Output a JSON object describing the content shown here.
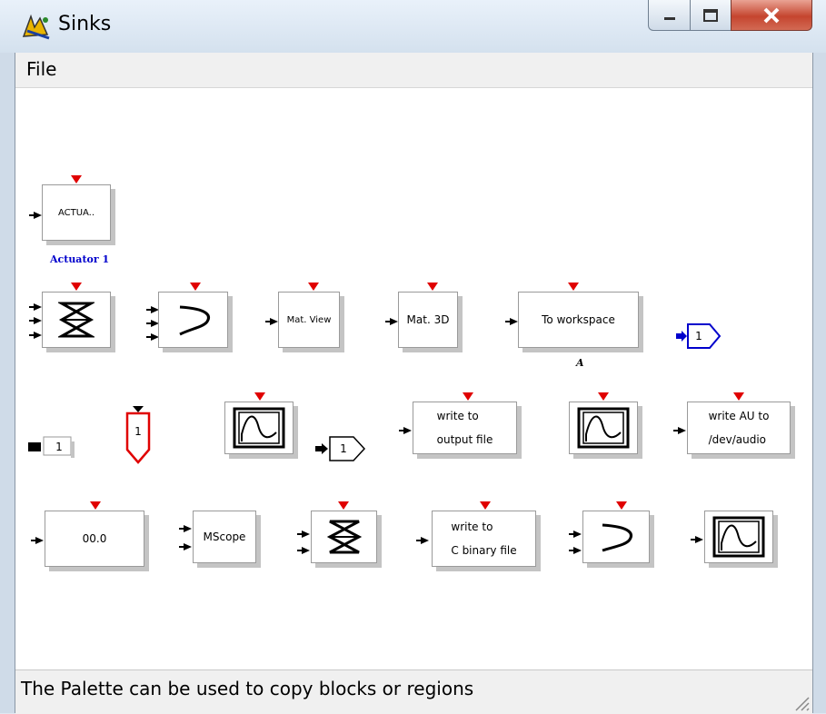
{
  "window": {
    "title": "Sinks"
  },
  "menu": {
    "file": "File"
  },
  "status": {
    "text": "The Palette can be used to copy blocks or regions"
  },
  "colors": {
    "event_port": "#e00000",
    "link_blue": "#0000cc"
  },
  "blocks": {
    "actuator": {
      "label": "ACTUA..",
      "caption": "Actuator 1"
    },
    "mat_view": {
      "label": "Mat. View"
    },
    "mat_3d": {
      "label": "Mat. 3D"
    },
    "to_workspace": {
      "label": "To workspace",
      "caption": "A"
    },
    "out_port_blue": {
      "label": "1"
    },
    "const_display": {
      "label": "1"
    },
    "event_out": {
      "label": "1"
    },
    "out_port": {
      "label": "1"
    },
    "write_output": {
      "line1": "write to",
      "line2": "output file"
    },
    "write_au": {
      "line1": "write AU to",
      "line2": "/dev/audio"
    },
    "affich": {
      "label": "00.0"
    },
    "mscope": {
      "label": "MScope"
    },
    "write_c": {
      "line1": "write to",
      "line2": "C binary file"
    }
  }
}
